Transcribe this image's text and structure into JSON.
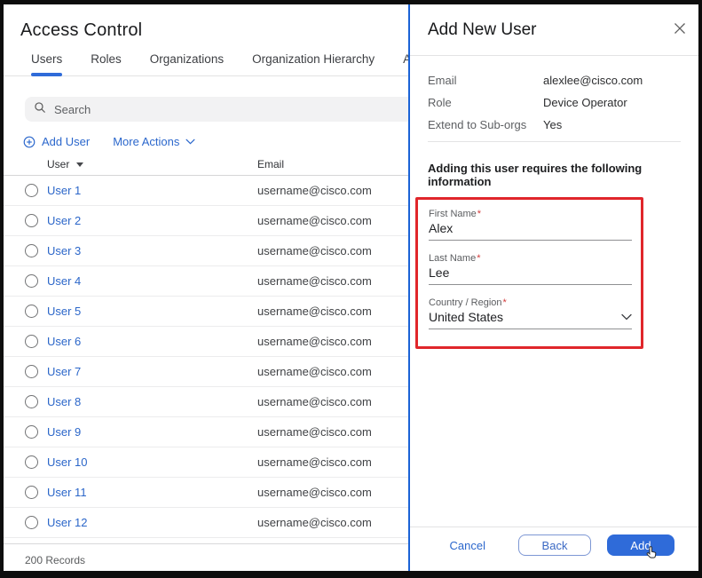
{
  "left_panel": {
    "title": "Access Control",
    "tabs": [
      {
        "label": "Users",
        "active": true
      },
      {
        "label": "Roles",
        "active": false
      },
      {
        "label": "Organizations",
        "active": false
      },
      {
        "label": "Organization Hierarchy",
        "active": false
      },
      {
        "label": "AP",
        "active": false
      }
    ],
    "search": {
      "placeholder": "Search"
    },
    "actions": {
      "add_user": "Add User",
      "more_actions": "More Actions"
    },
    "table": {
      "columns": {
        "user": "User",
        "email": "Email"
      },
      "rows": [
        {
          "user": "User 1",
          "email": "username@cisco.com"
        },
        {
          "user": "User 2",
          "email": "username@cisco.com"
        },
        {
          "user": "User 3",
          "email": "username@cisco.com"
        },
        {
          "user": "User 4",
          "email": "username@cisco.com"
        },
        {
          "user": "User 5",
          "email": "username@cisco.com"
        },
        {
          "user": "User 6",
          "email": "username@cisco.com"
        },
        {
          "user": "User 7",
          "email": "username@cisco.com"
        },
        {
          "user": "User 8",
          "email": "username@cisco.com"
        },
        {
          "user": "User 9",
          "email": "username@cisco.com"
        },
        {
          "user": "User 10",
          "email": "username@cisco.com"
        },
        {
          "user": "User 11",
          "email": "username@cisco.com"
        },
        {
          "user": "User 12",
          "email": "username@cisco.com"
        }
      ],
      "footer": "200 Records"
    }
  },
  "dialog": {
    "title": "Add New User",
    "summary": [
      {
        "label": "Email",
        "value": "alexlee@cisco.com"
      },
      {
        "label": "Role",
        "value": "Device Operator"
      },
      {
        "label": "Extend to Sub-orgs",
        "value": "Yes"
      }
    ],
    "section_heading": "Adding this user requires the following information",
    "required_marker": "*",
    "fields": [
      {
        "label": "First Name",
        "value": "Alex",
        "type": "text",
        "required": true
      },
      {
        "label": "Last Name",
        "value": "Lee",
        "type": "text",
        "required": true
      },
      {
        "label": "Country / Region",
        "value": "United States",
        "type": "select",
        "required": true
      }
    ],
    "buttons": {
      "cancel": "Cancel",
      "back": "Back",
      "add": "Add"
    }
  },
  "colors": {
    "accent_blue": "#2b67cc",
    "primary_button_blue": "#2f6bd9",
    "tab_underline_blue": "#2f6bd9",
    "dialog_border_blue": "#1b63d6",
    "highlight_red": "#e0262b"
  }
}
